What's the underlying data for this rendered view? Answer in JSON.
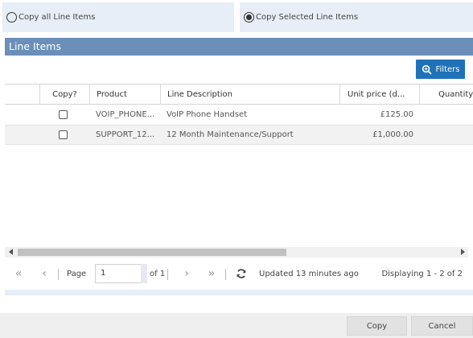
{
  "copy_options": {
    "all_label": "Copy all Line Items",
    "selected_label": "Copy Selected Line Items",
    "selected": "selected"
  },
  "section": {
    "title": "Line Items"
  },
  "toolbar": {
    "filters_label": "Filters"
  },
  "grid": {
    "columns": [
      "Copy?",
      "Product",
      "Line Description",
      "Unit price (d...",
      "Quantity"
    ],
    "rows": [
      {
        "checked": false,
        "product": "VOIP_PHONE...",
        "description": "VoIP Phone Handset",
        "unit_price": "£125.00"
      },
      {
        "checked": false,
        "product": "SUPPORT_12...",
        "description": "12 Month Maintenance/Support",
        "unit_price": "£1,000.00"
      }
    ]
  },
  "pager": {
    "page_label": "Page",
    "page_value": "1",
    "of_label": "of 1",
    "updated_text": "Updated 13 minutes ago",
    "displaying_text": "Displaying 1 - 2 of 2"
  },
  "footer": {
    "copy_label": "Copy",
    "cancel_label": "Cancel"
  },
  "colors": {
    "header_bg": "#6b8fb8",
    "filter_btn": "#1f72b8",
    "option_bg": "#e8eef7"
  }
}
